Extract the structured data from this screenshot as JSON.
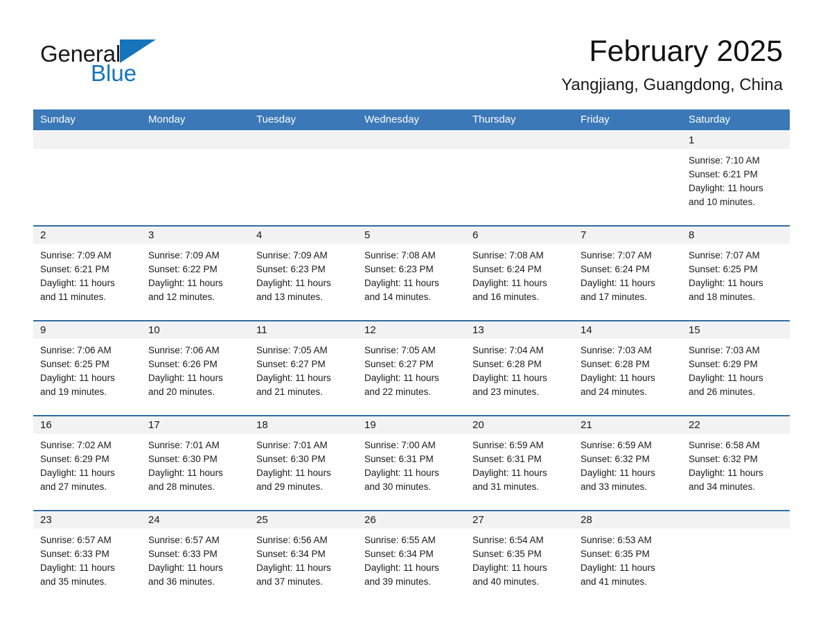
{
  "brand": {
    "name_part1": "General",
    "name_part2": "Blue",
    "flag_icon": "blue-triangle-flag-icon",
    "accent_color": "#1574bb"
  },
  "header": {
    "month_title": "February 2025",
    "location": "Yangjiang, Guangdong, China"
  },
  "calendar": {
    "header_bg": "#3b78b8",
    "row_divider_color": "#2e6da4",
    "daynum_band_bg": "#f2f2f2",
    "weekdays": [
      "Sunday",
      "Monday",
      "Tuesday",
      "Wednesday",
      "Thursday",
      "Friday",
      "Saturday"
    ],
    "weeks": [
      [
        {
          "day": "",
          "sunrise": "",
          "sunset": "",
          "daylight_line1": "",
          "daylight_line2": ""
        },
        {
          "day": "",
          "sunrise": "",
          "sunset": "",
          "daylight_line1": "",
          "daylight_line2": ""
        },
        {
          "day": "",
          "sunrise": "",
          "sunset": "",
          "daylight_line1": "",
          "daylight_line2": ""
        },
        {
          "day": "",
          "sunrise": "",
          "sunset": "",
          "daylight_line1": "",
          "daylight_line2": ""
        },
        {
          "day": "",
          "sunrise": "",
          "sunset": "",
          "daylight_line1": "",
          "daylight_line2": ""
        },
        {
          "day": "",
          "sunrise": "",
          "sunset": "",
          "daylight_line1": "",
          "daylight_line2": ""
        },
        {
          "day": "1",
          "sunrise": "Sunrise: 7:10 AM",
          "sunset": "Sunset: 6:21 PM",
          "daylight_line1": "Daylight: 11 hours",
          "daylight_line2": "and 10 minutes."
        }
      ],
      [
        {
          "day": "2",
          "sunrise": "Sunrise: 7:09 AM",
          "sunset": "Sunset: 6:21 PM",
          "daylight_line1": "Daylight: 11 hours",
          "daylight_line2": "and 11 minutes."
        },
        {
          "day": "3",
          "sunrise": "Sunrise: 7:09 AM",
          "sunset": "Sunset: 6:22 PM",
          "daylight_line1": "Daylight: 11 hours",
          "daylight_line2": "and 12 minutes."
        },
        {
          "day": "4",
          "sunrise": "Sunrise: 7:09 AM",
          "sunset": "Sunset: 6:23 PM",
          "daylight_line1": "Daylight: 11 hours",
          "daylight_line2": "and 13 minutes."
        },
        {
          "day": "5",
          "sunrise": "Sunrise: 7:08 AM",
          "sunset": "Sunset: 6:23 PM",
          "daylight_line1": "Daylight: 11 hours",
          "daylight_line2": "and 14 minutes."
        },
        {
          "day": "6",
          "sunrise": "Sunrise: 7:08 AM",
          "sunset": "Sunset: 6:24 PM",
          "daylight_line1": "Daylight: 11 hours",
          "daylight_line2": "and 16 minutes."
        },
        {
          "day": "7",
          "sunrise": "Sunrise: 7:07 AM",
          "sunset": "Sunset: 6:24 PM",
          "daylight_line1": "Daylight: 11 hours",
          "daylight_line2": "and 17 minutes."
        },
        {
          "day": "8",
          "sunrise": "Sunrise: 7:07 AM",
          "sunset": "Sunset: 6:25 PM",
          "daylight_line1": "Daylight: 11 hours",
          "daylight_line2": "and 18 minutes."
        }
      ],
      [
        {
          "day": "9",
          "sunrise": "Sunrise: 7:06 AM",
          "sunset": "Sunset: 6:25 PM",
          "daylight_line1": "Daylight: 11 hours",
          "daylight_line2": "and 19 minutes."
        },
        {
          "day": "10",
          "sunrise": "Sunrise: 7:06 AM",
          "sunset": "Sunset: 6:26 PM",
          "daylight_line1": "Daylight: 11 hours",
          "daylight_line2": "and 20 minutes."
        },
        {
          "day": "11",
          "sunrise": "Sunrise: 7:05 AM",
          "sunset": "Sunset: 6:27 PM",
          "daylight_line1": "Daylight: 11 hours",
          "daylight_line2": "and 21 minutes."
        },
        {
          "day": "12",
          "sunrise": "Sunrise: 7:05 AM",
          "sunset": "Sunset: 6:27 PM",
          "daylight_line1": "Daylight: 11 hours",
          "daylight_line2": "and 22 minutes."
        },
        {
          "day": "13",
          "sunrise": "Sunrise: 7:04 AM",
          "sunset": "Sunset: 6:28 PM",
          "daylight_line1": "Daylight: 11 hours",
          "daylight_line2": "and 23 minutes."
        },
        {
          "day": "14",
          "sunrise": "Sunrise: 7:03 AM",
          "sunset": "Sunset: 6:28 PM",
          "daylight_line1": "Daylight: 11 hours",
          "daylight_line2": "and 24 minutes."
        },
        {
          "day": "15",
          "sunrise": "Sunrise: 7:03 AM",
          "sunset": "Sunset: 6:29 PM",
          "daylight_line1": "Daylight: 11 hours",
          "daylight_line2": "and 26 minutes."
        }
      ],
      [
        {
          "day": "16",
          "sunrise": "Sunrise: 7:02 AM",
          "sunset": "Sunset: 6:29 PM",
          "daylight_line1": "Daylight: 11 hours",
          "daylight_line2": "and 27 minutes."
        },
        {
          "day": "17",
          "sunrise": "Sunrise: 7:01 AM",
          "sunset": "Sunset: 6:30 PM",
          "daylight_line1": "Daylight: 11 hours",
          "daylight_line2": "and 28 minutes."
        },
        {
          "day": "18",
          "sunrise": "Sunrise: 7:01 AM",
          "sunset": "Sunset: 6:30 PM",
          "daylight_line1": "Daylight: 11 hours",
          "daylight_line2": "and 29 minutes."
        },
        {
          "day": "19",
          "sunrise": "Sunrise: 7:00 AM",
          "sunset": "Sunset: 6:31 PM",
          "daylight_line1": "Daylight: 11 hours",
          "daylight_line2": "and 30 minutes."
        },
        {
          "day": "20",
          "sunrise": "Sunrise: 6:59 AM",
          "sunset": "Sunset: 6:31 PM",
          "daylight_line1": "Daylight: 11 hours",
          "daylight_line2": "and 31 minutes."
        },
        {
          "day": "21",
          "sunrise": "Sunrise: 6:59 AM",
          "sunset": "Sunset: 6:32 PM",
          "daylight_line1": "Daylight: 11 hours",
          "daylight_line2": "and 33 minutes."
        },
        {
          "day": "22",
          "sunrise": "Sunrise: 6:58 AM",
          "sunset": "Sunset: 6:32 PM",
          "daylight_line1": "Daylight: 11 hours",
          "daylight_line2": "and 34 minutes."
        }
      ],
      [
        {
          "day": "23",
          "sunrise": "Sunrise: 6:57 AM",
          "sunset": "Sunset: 6:33 PM",
          "daylight_line1": "Daylight: 11 hours",
          "daylight_line2": "and 35 minutes."
        },
        {
          "day": "24",
          "sunrise": "Sunrise: 6:57 AM",
          "sunset": "Sunset: 6:33 PM",
          "daylight_line1": "Daylight: 11 hours",
          "daylight_line2": "and 36 minutes."
        },
        {
          "day": "25",
          "sunrise": "Sunrise: 6:56 AM",
          "sunset": "Sunset: 6:34 PM",
          "daylight_line1": "Daylight: 11 hours",
          "daylight_line2": "and 37 minutes."
        },
        {
          "day": "26",
          "sunrise": "Sunrise: 6:55 AM",
          "sunset": "Sunset: 6:34 PM",
          "daylight_line1": "Daylight: 11 hours",
          "daylight_line2": "and 39 minutes."
        },
        {
          "day": "27",
          "sunrise": "Sunrise: 6:54 AM",
          "sunset": "Sunset: 6:35 PM",
          "daylight_line1": "Daylight: 11 hours",
          "daylight_line2": "and 40 minutes."
        },
        {
          "day": "28",
          "sunrise": "Sunrise: 6:53 AM",
          "sunset": "Sunset: 6:35 PM",
          "daylight_line1": "Daylight: 11 hours",
          "daylight_line2": "and 41 minutes."
        },
        {
          "day": "",
          "sunrise": "",
          "sunset": "",
          "daylight_line1": "",
          "daylight_line2": ""
        }
      ]
    ]
  }
}
